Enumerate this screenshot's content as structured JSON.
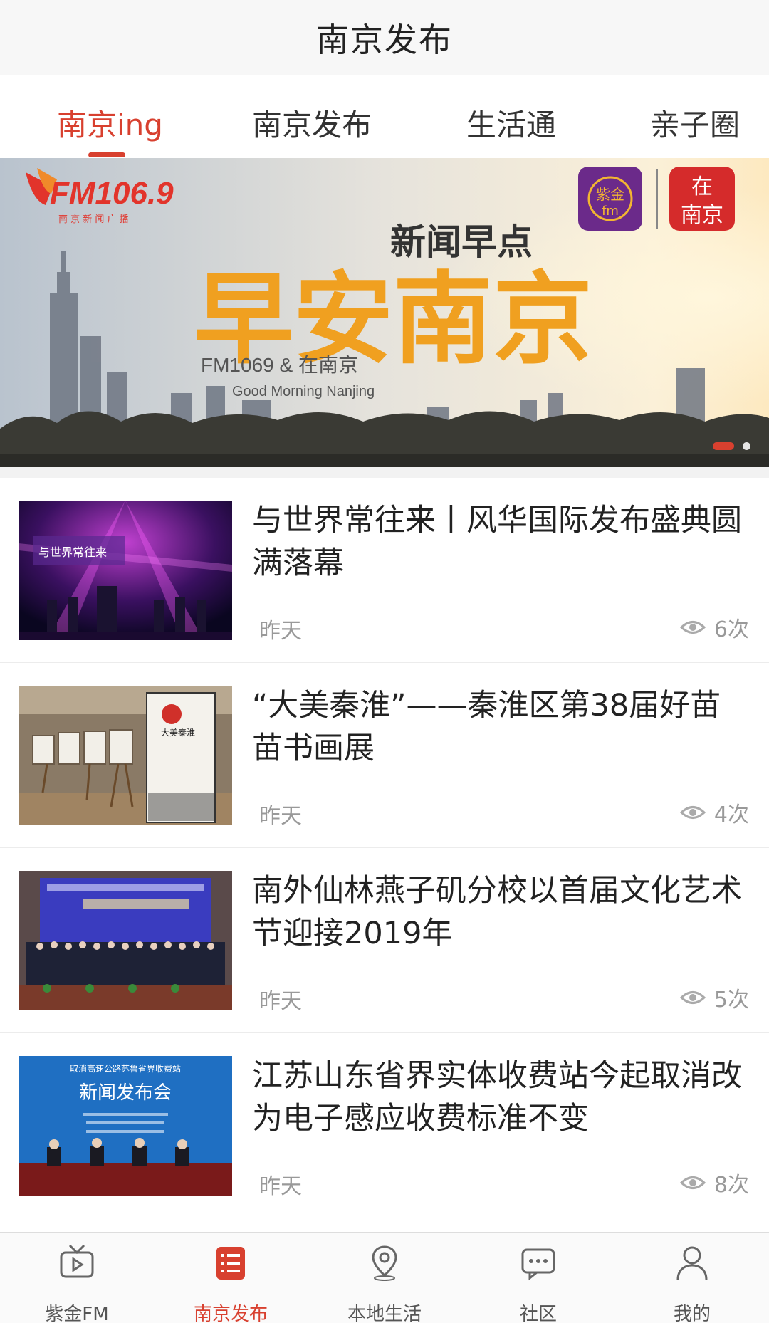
{
  "header": {
    "title": "南京发布"
  },
  "tabs": [
    {
      "label": "南京ing",
      "active": true
    },
    {
      "label": "南京发布",
      "active": false
    },
    {
      "label": "生活通",
      "active": false
    },
    {
      "label": "亲子圈",
      "active": false
    }
  ],
  "banner": {
    "brand_logo": "FM106.9",
    "brand_sub": "南 京 新 闻 广 播",
    "badge_left": "紫金",
    "badge_left_sub": "fm",
    "badge_right_top": "在",
    "badge_right_bottom": "南京",
    "headline_small": "新闻早点",
    "headline_big": "早安南京",
    "caption_cn": "FM1069 & 在南京",
    "caption_en": "Good Morning Nanjing",
    "page_index": 1,
    "page_count": 2
  },
  "articles": [
    {
      "title": "与世界常往来丨风华国际发布盛典圆满落幕",
      "date": "昨天",
      "views": "6次",
      "thumb_text": "与世界常往来"
    },
    {
      "title": "“大美秦淮”——秦淮区第38届好苗苗书画展",
      "date": "昨天",
      "views": "4次",
      "thumb_text": "大美秦淮"
    },
    {
      "title": "南外仙林燕子矶分校以首届文化艺术节迎接2019年",
      "date": "昨天",
      "views": "5次",
      "thumb_text": ""
    },
    {
      "title": "江苏山东省界实体收费站今起取消改为电子感应收费标准不变",
      "date": "昨天",
      "views": "8次",
      "thumb_text": "新闻发布会",
      "thumb_subtext": "取消高速公路苏鲁省界收费站"
    }
  ],
  "tabbar": [
    {
      "label": "紫金FM",
      "icon": "tv-icon",
      "active": false
    },
    {
      "label": "南京发布",
      "icon": "list-icon",
      "active": true
    },
    {
      "label": "本地生活",
      "icon": "location-pin-icon",
      "active": false
    },
    {
      "label": "社区",
      "icon": "chat-bubble-icon",
      "active": false
    },
    {
      "label": "我的",
      "icon": "person-icon",
      "active": false
    }
  ],
  "colors": {
    "accent": "#d8402f",
    "banner_orange": "#f0a020",
    "muted": "#999999"
  }
}
